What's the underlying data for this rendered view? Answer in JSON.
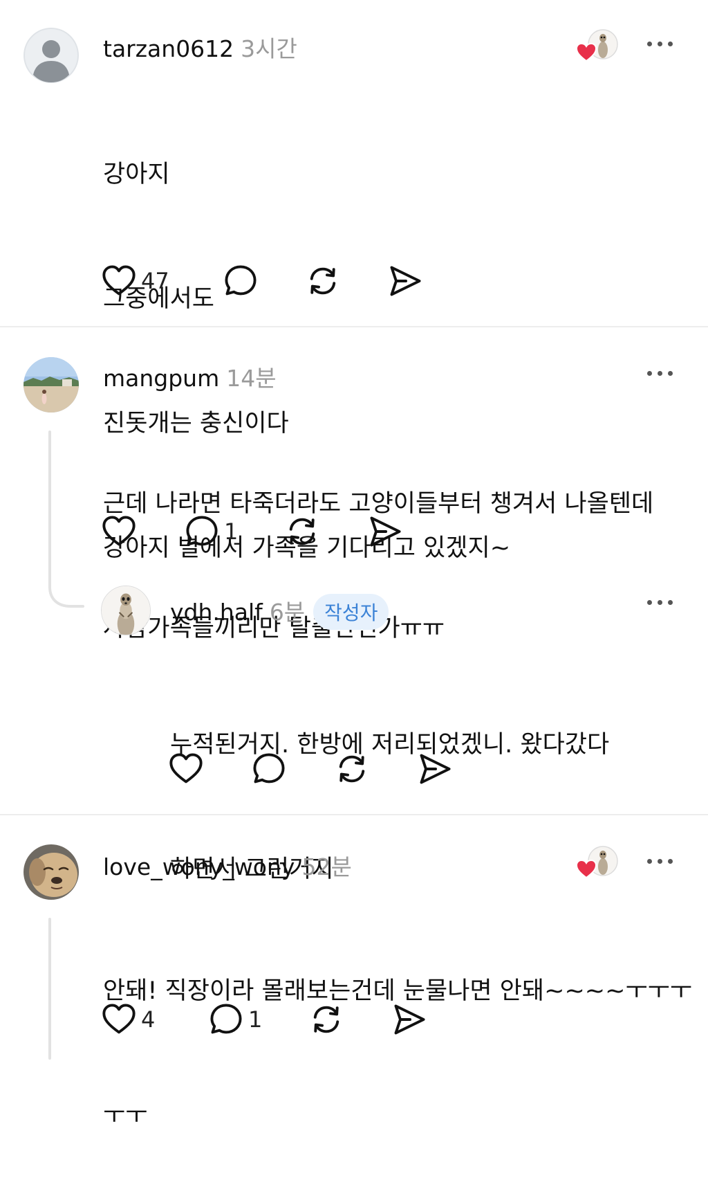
{
  "posts": [
    {
      "username": "tarzan0612",
      "time": "3시간",
      "lines": [
        "강아지",
        "그중에서도",
        "진돗개는 충신이다",
        "강아지 별에서 가족을 기다리고 있겠지~"
      ],
      "like_count": "47",
      "reply_count": "",
      "author_liked": true
    },
    {
      "username": "mangpum",
      "time": "14분",
      "lines": [
        "근데 나라면 타죽더라도 고양이들부터 챙겨서 나올텐데",
        "사람가족들끼리만 탈출한건가ㅠㅠ"
      ],
      "like_count": "",
      "reply_count": "1",
      "reply": {
        "username": "ydh.half",
        "time": "6분",
        "badge": "작성자",
        "lines": [
          "누적된거지. 한방에 저리되었겠니. 왔다갔다",
          "하면서 그런거지"
        ]
      }
    },
    {
      "username": "love_wony_wony",
      "time": "52분",
      "lines": [
        "안돼! 직장이라 몰래보는건데 눈물나면 안돼~~~~ㅜㅜㅜ",
        "ㅜㅜ"
      ],
      "like_count": "4",
      "reply_count": "1",
      "author_liked": true
    }
  ],
  "colors": {
    "heart": "#e8304a",
    "badge_text": "#3b82d6",
    "badge_bg": "#e7f1fc",
    "muted": "#9a9a9a"
  },
  "icons": [
    "heart-icon",
    "comment-icon",
    "repost-icon",
    "share-icon",
    "more-icon",
    "author-liked-icon"
  ]
}
